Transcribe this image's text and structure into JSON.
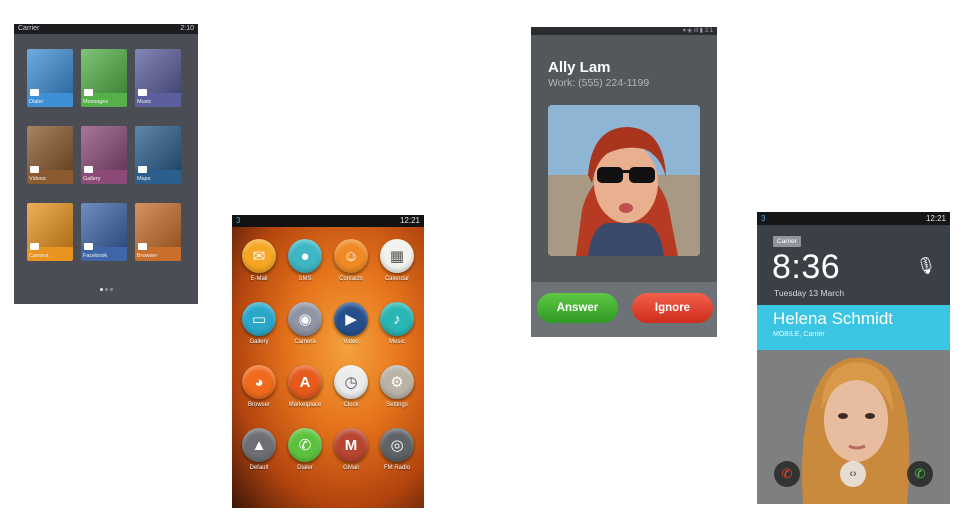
{
  "screen1": {
    "status_bar": {
      "carrier": "Carrier",
      "time": "2:10"
    },
    "tiles": [
      {
        "label": "Dialer",
        "icon": "phone-icon",
        "color": "#3e8fd6"
      },
      {
        "label": "Messages",
        "icon": "message-icon",
        "color": "#55b04a"
      },
      {
        "label": "Music",
        "icon": "music-icon",
        "color": "#5b5f9d"
      },
      {
        "label": "Videos",
        "icon": "video-icon",
        "color": "#8b5a2e"
      },
      {
        "label": "Gallery",
        "icon": "gallery-icon",
        "color": "#8b4a78"
      },
      {
        "label": "Maps",
        "icon": "maps-icon",
        "color": "#2b5f8e"
      },
      {
        "label": "Camera",
        "icon": "camera-icon",
        "color": "#e8941f"
      },
      {
        "label": "Facebook",
        "icon": "facebook-icon",
        "color": "#3e66a8"
      },
      {
        "label": "Browser",
        "icon": "browser-icon",
        "color": "#c96f2e"
      }
    ],
    "page_dots": 3,
    "active_page": 0
  },
  "screen2": {
    "status_bar": {
      "notifications": "3",
      "time": "12:21"
    },
    "apps": [
      {
        "label": "E-Mail",
        "icon": "email-icon",
        "color": "#f5a623"
      },
      {
        "label": "SMS",
        "icon": "sms-icon",
        "color": "#3fb6c3"
      },
      {
        "label": "Contacts",
        "icon": "contacts-icon",
        "color": "#f08a24"
      },
      {
        "label": "Calendar",
        "icon": "calendar-icon",
        "color": "#f2f2ee"
      },
      {
        "label": "Gallery",
        "icon": "gallery-icon",
        "color": "#2aa7c9"
      },
      {
        "label": "Camera",
        "icon": "camera-icon",
        "color": "#8f95a3"
      },
      {
        "label": "Video",
        "icon": "video-icon",
        "color": "#25508c"
      },
      {
        "label": "Music",
        "icon": "music-icon",
        "color": "#2ab6b4"
      },
      {
        "label": "Browser",
        "icon": "firefox-icon",
        "color": "#f06a1d"
      },
      {
        "label": "Marketplace",
        "icon": "marketplace-icon",
        "color": "#e65a1c"
      },
      {
        "label": "Clock",
        "icon": "clock-icon",
        "color": "#ececec"
      },
      {
        "label": "Settings",
        "icon": "settings-icon",
        "color": "#b9b3a8"
      },
      {
        "label": "Default",
        "icon": "rocket-icon",
        "color": "#6d6f74"
      },
      {
        "label": "Dialer",
        "icon": "phone-icon",
        "color": "#5cc23d"
      },
      {
        "label": "GMail",
        "icon": "gmail-icon",
        "color": "#b8452f"
      },
      {
        "label": "FM Radio",
        "icon": "radio-icon",
        "color": "#5f6266"
      }
    ]
  },
  "screen3": {
    "caller_name": "Ally Lam",
    "caller_number": "Work: (555) 224-1199",
    "answer_label": "Answer",
    "ignore_label": "Ignore"
  },
  "screen4": {
    "status_bar": {
      "notifications": "3",
      "time": "12:21"
    },
    "carrier": "Carrier",
    "time": "8:36",
    "date": "Tuesday 13 March",
    "caller_name": "Helena Schmidt",
    "caller_sub": "MOBILE, Carrier"
  }
}
